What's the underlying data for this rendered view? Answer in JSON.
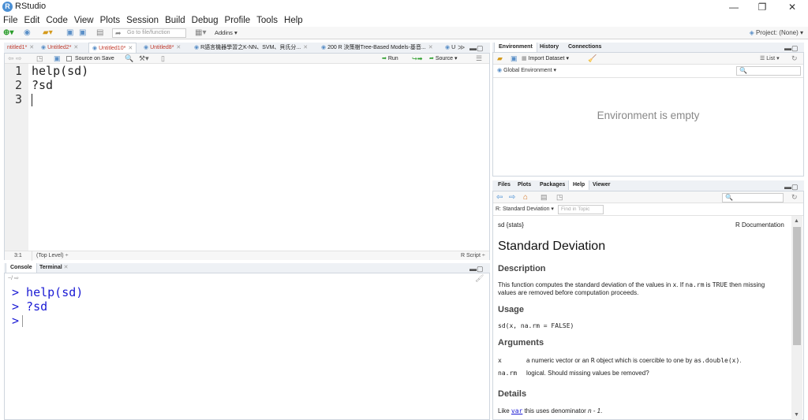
{
  "app": {
    "title": "RStudio"
  },
  "menu": [
    "File",
    "Edit",
    "Code",
    "View",
    "Plots",
    "Session",
    "Build",
    "Debug",
    "Profile",
    "Tools",
    "Help"
  ],
  "toolbar": {
    "goto_placeholder": "Go to file/function",
    "addins": "Addins",
    "project": "Project: (None)"
  },
  "source": {
    "tabs": [
      {
        "label": "ntitled1*",
        "active": false
      },
      {
        "label": "Untitled2*",
        "active": false
      },
      {
        "label": "Untitled10*",
        "active": true
      },
      {
        "label": "Untitled8*",
        "active": false
      },
      {
        "label": "R語言機器學習之K-NN、SVM、貝氏分...",
        "active": false
      },
      {
        "label": "200 R 決策樹Tree-Based Models-基音...",
        "active": false
      },
      {
        "label": "U",
        "active": false
      }
    ],
    "source_on_save": "Source on Save",
    "run": "Run",
    "source_btn": "Source",
    "lines": [
      "help(sd)",
      "?sd",
      ""
    ],
    "line_numbers": [
      "1",
      "2",
      "3"
    ],
    "status_pos": "3:1",
    "status_scope": "(Top Level) ÷",
    "status_type": "R Script ÷"
  },
  "console": {
    "tabs": [
      "Console",
      "Terminal"
    ],
    "path": "~/",
    "lines": [
      "> help(sd)",
      "> ?sd",
      "> "
    ]
  },
  "env": {
    "tabs": [
      "Environment",
      "History",
      "Connections"
    ],
    "import": "Import Dataset",
    "list": "List",
    "scope": "Global Environment",
    "empty": "Environment is empty"
  },
  "help": {
    "tabs": [
      "Files",
      "Plots",
      "Packages",
      "Help",
      "Viewer"
    ],
    "topic": "R: Standard Deviation",
    "find_placeholder": "Find in Topic",
    "pkg": "sd {stats}",
    "rdoc": "R Documentation",
    "title": "Standard Deviation",
    "description_h": "Description",
    "description_a": "This function computes the standard deviation of the values in ",
    "description_x": "x",
    "description_b": ". If ",
    "description_narm": "na.rm",
    "description_c": " is ",
    "description_true": "TRUE",
    "description_d": " then missing",
    "description_e": "values are removed before computation proceeds.",
    "usage_h": "Usage",
    "usage": "sd(x, na.rm = FALSE)",
    "arguments_h": "Arguments",
    "arg1_name": "x",
    "arg1_a": "a numeric vector or an ",
    "arg1_r": "R",
    "arg1_b": " object which is coercible to one by ",
    "arg1_c": "as.double(x)",
    "arg1_d": ".",
    "arg2_name": "na.rm",
    "arg2_desc": "logical. Should missing values be removed?",
    "details_h": "Details",
    "details_a": "Like ",
    "details_var": "var",
    "details_b": " this uses denominator ",
    "details_n": "n - 1",
    "details_c": "."
  }
}
